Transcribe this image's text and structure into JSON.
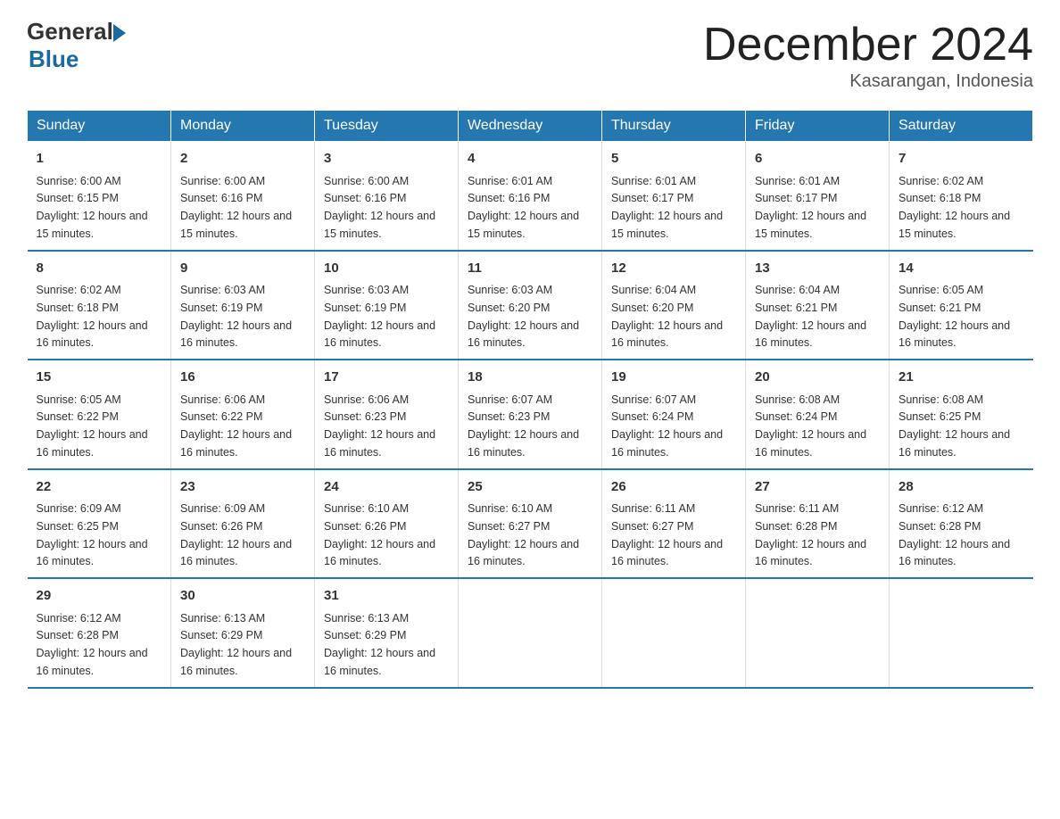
{
  "header": {
    "logo_general": "General",
    "logo_blue": "Blue",
    "title": "December 2024",
    "location": "Kasarangan, Indonesia"
  },
  "days_of_week": [
    "Sunday",
    "Monday",
    "Tuesday",
    "Wednesday",
    "Thursday",
    "Friday",
    "Saturday"
  ],
  "weeks": [
    [
      {
        "day": "1",
        "sunrise": "6:00 AM",
        "sunset": "6:15 PM",
        "daylight": "12 hours and 15 minutes."
      },
      {
        "day": "2",
        "sunrise": "6:00 AM",
        "sunset": "6:16 PM",
        "daylight": "12 hours and 15 minutes."
      },
      {
        "day": "3",
        "sunrise": "6:00 AM",
        "sunset": "6:16 PM",
        "daylight": "12 hours and 15 minutes."
      },
      {
        "day": "4",
        "sunrise": "6:01 AM",
        "sunset": "6:16 PM",
        "daylight": "12 hours and 15 minutes."
      },
      {
        "day": "5",
        "sunrise": "6:01 AM",
        "sunset": "6:17 PM",
        "daylight": "12 hours and 15 minutes."
      },
      {
        "day": "6",
        "sunrise": "6:01 AM",
        "sunset": "6:17 PM",
        "daylight": "12 hours and 15 minutes."
      },
      {
        "day": "7",
        "sunrise": "6:02 AM",
        "sunset": "6:18 PM",
        "daylight": "12 hours and 15 minutes."
      }
    ],
    [
      {
        "day": "8",
        "sunrise": "6:02 AM",
        "sunset": "6:18 PM",
        "daylight": "12 hours and 16 minutes."
      },
      {
        "day": "9",
        "sunrise": "6:03 AM",
        "sunset": "6:19 PM",
        "daylight": "12 hours and 16 minutes."
      },
      {
        "day": "10",
        "sunrise": "6:03 AM",
        "sunset": "6:19 PM",
        "daylight": "12 hours and 16 minutes."
      },
      {
        "day": "11",
        "sunrise": "6:03 AM",
        "sunset": "6:20 PM",
        "daylight": "12 hours and 16 minutes."
      },
      {
        "day": "12",
        "sunrise": "6:04 AM",
        "sunset": "6:20 PM",
        "daylight": "12 hours and 16 minutes."
      },
      {
        "day": "13",
        "sunrise": "6:04 AM",
        "sunset": "6:21 PM",
        "daylight": "12 hours and 16 minutes."
      },
      {
        "day": "14",
        "sunrise": "6:05 AM",
        "sunset": "6:21 PM",
        "daylight": "12 hours and 16 minutes."
      }
    ],
    [
      {
        "day": "15",
        "sunrise": "6:05 AM",
        "sunset": "6:22 PM",
        "daylight": "12 hours and 16 minutes."
      },
      {
        "day": "16",
        "sunrise": "6:06 AM",
        "sunset": "6:22 PM",
        "daylight": "12 hours and 16 minutes."
      },
      {
        "day": "17",
        "sunrise": "6:06 AM",
        "sunset": "6:23 PM",
        "daylight": "12 hours and 16 minutes."
      },
      {
        "day": "18",
        "sunrise": "6:07 AM",
        "sunset": "6:23 PM",
        "daylight": "12 hours and 16 minutes."
      },
      {
        "day": "19",
        "sunrise": "6:07 AM",
        "sunset": "6:24 PM",
        "daylight": "12 hours and 16 minutes."
      },
      {
        "day": "20",
        "sunrise": "6:08 AM",
        "sunset": "6:24 PM",
        "daylight": "12 hours and 16 minutes."
      },
      {
        "day": "21",
        "sunrise": "6:08 AM",
        "sunset": "6:25 PM",
        "daylight": "12 hours and 16 minutes."
      }
    ],
    [
      {
        "day": "22",
        "sunrise": "6:09 AM",
        "sunset": "6:25 PM",
        "daylight": "12 hours and 16 minutes."
      },
      {
        "day": "23",
        "sunrise": "6:09 AM",
        "sunset": "6:26 PM",
        "daylight": "12 hours and 16 minutes."
      },
      {
        "day": "24",
        "sunrise": "6:10 AM",
        "sunset": "6:26 PM",
        "daylight": "12 hours and 16 minutes."
      },
      {
        "day": "25",
        "sunrise": "6:10 AM",
        "sunset": "6:27 PM",
        "daylight": "12 hours and 16 minutes."
      },
      {
        "day": "26",
        "sunrise": "6:11 AM",
        "sunset": "6:27 PM",
        "daylight": "12 hours and 16 minutes."
      },
      {
        "day": "27",
        "sunrise": "6:11 AM",
        "sunset": "6:28 PM",
        "daylight": "12 hours and 16 minutes."
      },
      {
        "day": "28",
        "sunrise": "6:12 AM",
        "sunset": "6:28 PM",
        "daylight": "12 hours and 16 minutes."
      }
    ],
    [
      {
        "day": "29",
        "sunrise": "6:12 AM",
        "sunset": "6:28 PM",
        "daylight": "12 hours and 16 minutes."
      },
      {
        "day": "30",
        "sunrise": "6:13 AM",
        "sunset": "6:29 PM",
        "daylight": "12 hours and 16 minutes."
      },
      {
        "day": "31",
        "sunrise": "6:13 AM",
        "sunset": "6:29 PM",
        "daylight": "12 hours and 16 minutes."
      },
      null,
      null,
      null,
      null
    ]
  ],
  "labels": {
    "sunrise": "Sunrise: ",
    "sunset": "Sunset: ",
    "daylight": "Daylight: "
  }
}
